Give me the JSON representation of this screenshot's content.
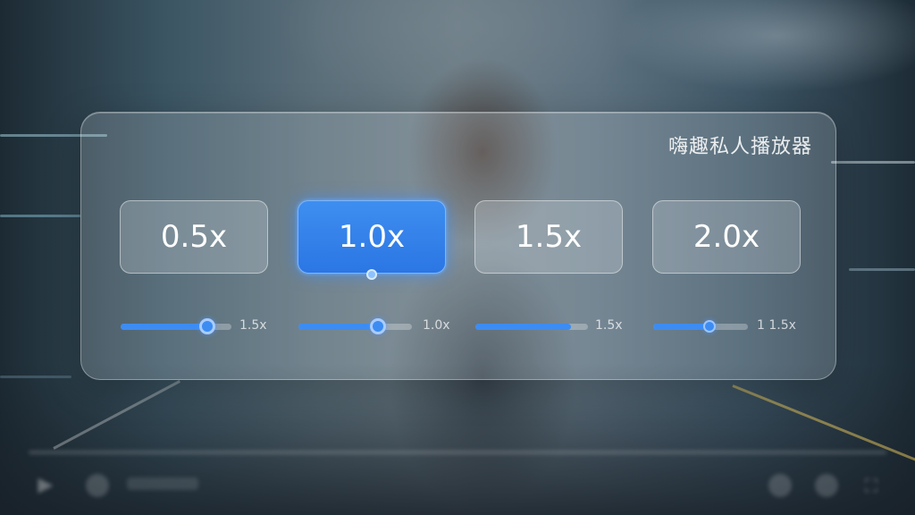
{
  "panel": {
    "title": "嗨趣私人播放器"
  },
  "speed_options": [
    {
      "label": "0.5x",
      "active": false
    },
    {
      "label": "1.0x",
      "active": true
    },
    {
      "label": "1.5x",
      "active": false
    },
    {
      "label": "2.0x",
      "active": false
    }
  ],
  "sliders": [
    {
      "fill_fraction": 0.78,
      "label": "1.5x"
    },
    {
      "fill_fraction": 0.7,
      "label": "1.0x"
    },
    {
      "fill_fraction": 0.85,
      "label": "1.5x"
    },
    {
      "fill_fraction": 0.59,
      "label": "1 1.5x"
    }
  ],
  "colors": {
    "accent": "#3d8cf2",
    "accent_glow": "#7cb6ff",
    "panel_glass": "rgba(225,232,238,0.18)",
    "text": "#ffffff"
  },
  "player_controls": {
    "icons": [
      "play-icon",
      "volume-icon",
      "settings-icon",
      "subtitle-icon",
      "fullscreen-icon"
    ]
  }
}
